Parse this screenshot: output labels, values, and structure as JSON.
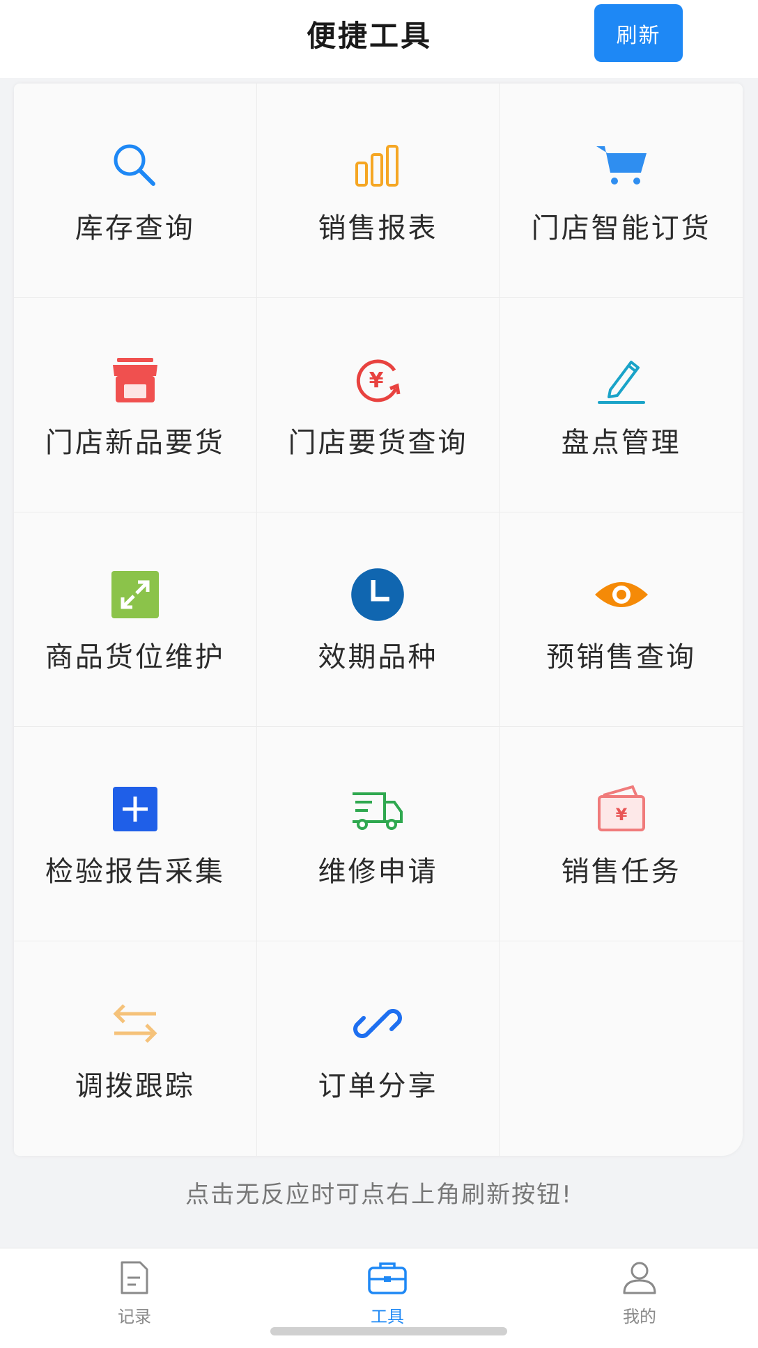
{
  "header": {
    "title": "便捷工具",
    "refresh_label": "刷新"
  },
  "tools": [
    {
      "label": "库存查询",
      "icon": "search-icon"
    },
    {
      "label": "销售报表",
      "icon": "bar-chart-icon"
    },
    {
      "label": "门店智能订货",
      "icon": "cart-icon"
    },
    {
      "label": "门店新品要货",
      "icon": "store-icon"
    },
    {
      "label": "门店要货查询",
      "icon": "yen-refresh-icon"
    },
    {
      "label": "盘点管理",
      "icon": "pencil-icon"
    },
    {
      "label": "商品货位维护",
      "icon": "expand-icon"
    },
    {
      "label": "效期品种",
      "icon": "clock-icon"
    },
    {
      "label": "预销售查询",
      "icon": "eye-icon"
    },
    {
      "label": "检验报告采集",
      "icon": "plus-square-icon"
    },
    {
      "label": "维修申请",
      "icon": "truck-icon"
    },
    {
      "label": "销售任务",
      "icon": "wallet-icon"
    },
    {
      "label": "调拨跟踪",
      "icon": "transfer-arrows-icon"
    },
    {
      "label": "订单分享",
      "icon": "link-icon"
    }
  ],
  "hint": "点击无反应时可点右上角刷新按钮!",
  "tabbar": {
    "items": [
      {
        "label": "记录",
        "icon": "document-icon",
        "active": false
      },
      {
        "label": "工具",
        "icon": "toolbox-icon",
        "active": true
      },
      {
        "label": "我的",
        "icon": "person-icon",
        "active": false
      }
    ]
  },
  "colors": {
    "accent": "#1e88f5",
    "orange": "#f5a623",
    "red": "#f0504f",
    "green": "#8bc34a",
    "teal": "#1aa3c8"
  }
}
